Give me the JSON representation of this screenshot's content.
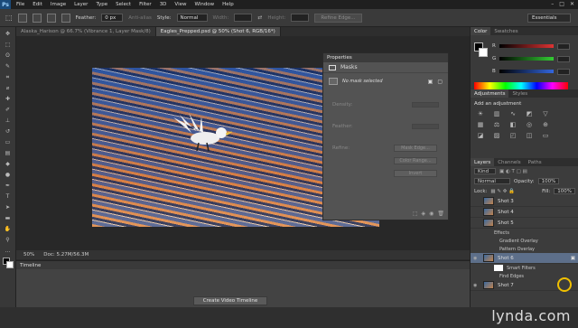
{
  "app": {
    "logo": "Ps"
  },
  "menu": [
    "File",
    "Edit",
    "Image",
    "Layer",
    "Type",
    "Select",
    "Filter",
    "3D",
    "View",
    "Window",
    "Help"
  ],
  "options": {
    "feather_label": "Feather:",
    "feather_value": "0 px",
    "antialias_label": "Anti-alias",
    "style_label": "Style:",
    "style_value": "Normal",
    "width_label": "Width:",
    "height_label": "Height:",
    "refine_label": "Refine Edge...",
    "workspace": "Essentials"
  },
  "doc_tabs": [
    {
      "label": "Alaska_Harison @ 66.7% (Vibrance 1, Layer Mask/8)"
    },
    {
      "label": "Eagles_Prepped.psd @ 50% (Shot 6, RGB/16*)"
    }
  ],
  "properties": {
    "title": "Properties",
    "section": "Masks",
    "mask_status": "No mask selected",
    "density_label": "Density:",
    "feather_label": "Feather:",
    "refine_label": "Refine:",
    "mask_edge": "Mask Edge...",
    "color_range": "Color Range...",
    "invert": "Invert"
  },
  "status": {
    "zoom": "50%",
    "doc": "Doc: 5.27M/56.3M"
  },
  "timeline": {
    "title": "Timeline",
    "create_button": "Create Video Timeline"
  },
  "color_panel": {
    "tab_color": "Color",
    "tab_swatches": "Swatches",
    "channels": [
      {
        "name": "R",
        "value": "",
        "color": "#d33"
      },
      {
        "name": "G",
        "value": "",
        "color": "#3c3"
      },
      {
        "name": "B",
        "value": "",
        "color": "#36d"
      }
    ]
  },
  "adjustments": {
    "tab_adjustments": "Adjustments",
    "tab_styles": "Styles",
    "title": "Add an adjustment"
  },
  "layers_panel": {
    "tabs": [
      "Layers",
      "Channels",
      "Paths"
    ],
    "kind_label": "Kind",
    "blend_mode": "Normal",
    "opacity_label": "Opacity:",
    "opacity_value": "100%",
    "lock_label": "Lock:",
    "fill_label": "Fill:",
    "fill_value": "100%",
    "layers": [
      {
        "name": "Shot 3"
      },
      {
        "name": "Shot 4"
      },
      {
        "name": "Shot 5"
      }
    ],
    "effects_label": "Effects",
    "effects": [
      "Gradient Overlay",
      "Pattern Overlay"
    ],
    "selected_layer": "Shot 6",
    "smart_filters_label": "Smart Filters",
    "filter_name": "Find Edges",
    "last_layer": "Shot 7"
  },
  "watermark": "lynda.com"
}
